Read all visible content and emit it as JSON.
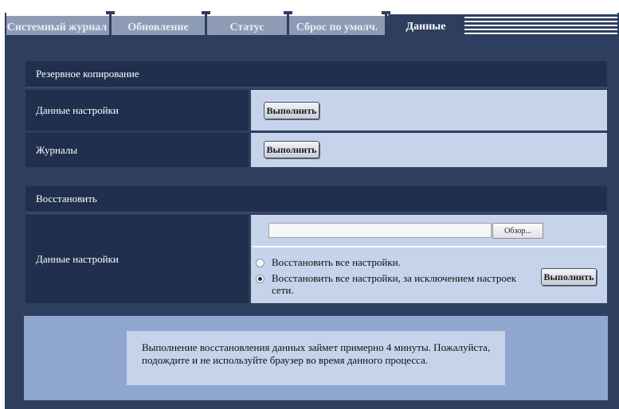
{
  "tabs": [
    {
      "label": "Системный журнал",
      "active": false
    },
    {
      "label": "Обновление",
      "active": false
    },
    {
      "label": "Статус",
      "active": false
    },
    {
      "label": "Сброс по умолч.",
      "active": false
    },
    {
      "label": "Данные",
      "active": true
    }
  ],
  "backup": {
    "title": "Резервное копирование",
    "rows": [
      {
        "label": "Данные настройки",
        "button": "Выполнить"
      },
      {
        "label": "Журналы",
        "button": "Выполнить"
      }
    ]
  },
  "restore": {
    "title": "Восстановить",
    "row_label": "Данные настройки",
    "file_value": "",
    "browse_label": "Обзор...",
    "options": [
      {
        "label": "Восстановить все настройки.",
        "checked": false
      },
      {
        "label": "Восстановить все настройки, за исключением настроек сети.",
        "checked": true
      }
    ],
    "button": "Выполнить"
  },
  "notice": {
    "text": "Выполнение восстановления данных займет примерно 4 минуты. Пожалуйста, подождите и не используйте браузер во время данного процесса."
  },
  "colors": {
    "panel": "#2d3e5e",
    "row_header": "#1f2f4d",
    "value_bg": "#c6d3ea",
    "notice_bg": "#8fa6cf",
    "tab_inactive": "#8e9bb5"
  }
}
